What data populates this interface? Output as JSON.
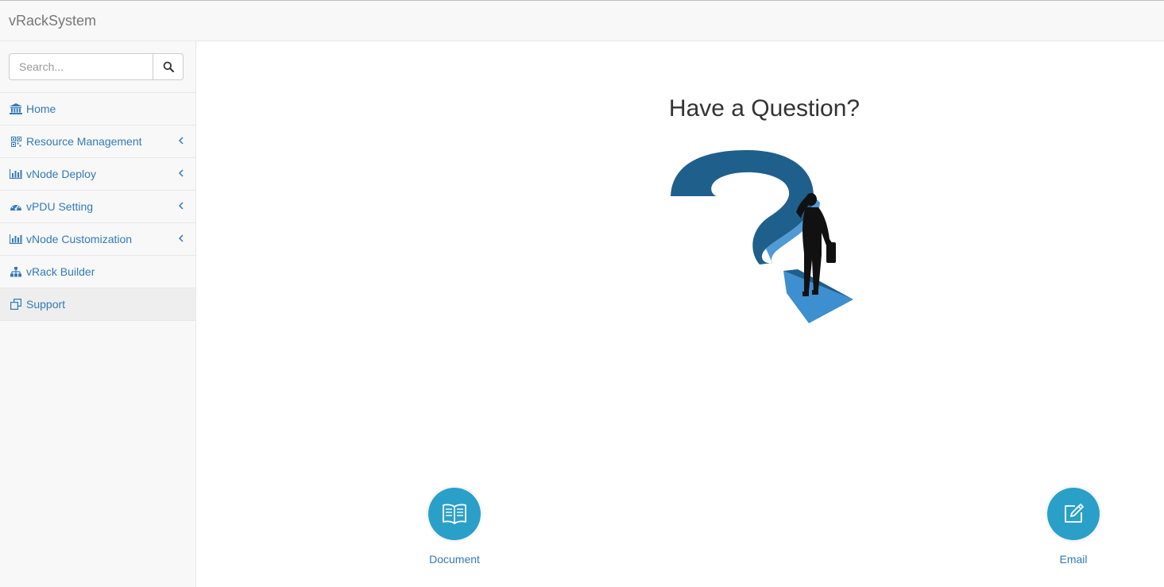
{
  "app": {
    "title": "vRackSystem"
  },
  "search": {
    "placeholder": "Search..."
  },
  "sidebar": {
    "items": [
      {
        "label": "Home",
        "icon": "bank-icon",
        "has_submenu": false
      },
      {
        "label": "Resource Management",
        "icon": "qrcode-icon",
        "has_submenu": true
      },
      {
        "label": "vNode Deploy",
        "icon": "bar-chart-icon",
        "has_submenu": true
      },
      {
        "label": "vPDU Setting",
        "icon": "dashboard-icon",
        "has_submenu": true
      },
      {
        "label": "vNode Customization",
        "icon": "bar-chart-icon",
        "has_submenu": true
      },
      {
        "label": "vRack Builder",
        "icon": "sitemap-icon",
        "has_submenu": false
      },
      {
        "label": "Support",
        "icon": "clone-icon",
        "has_submenu": false,
        "active": true
      }
    ]
  },
  "main": {
    "title": "Have a Question?",
    "actions": [
      {
        "label": "Document",
        "icon": "book-icon"
      },
      {
        "label": "Email",
        "icon": "edit-icon"
      }
    ]
  },
  "colors": {
    "link": "#337ab7",
    "accent_circle": "#2aa0c9",
    "question_mark_dark": "#1f5f8b",
    "question_mark_light": "#3d8fd0"
  }
}
